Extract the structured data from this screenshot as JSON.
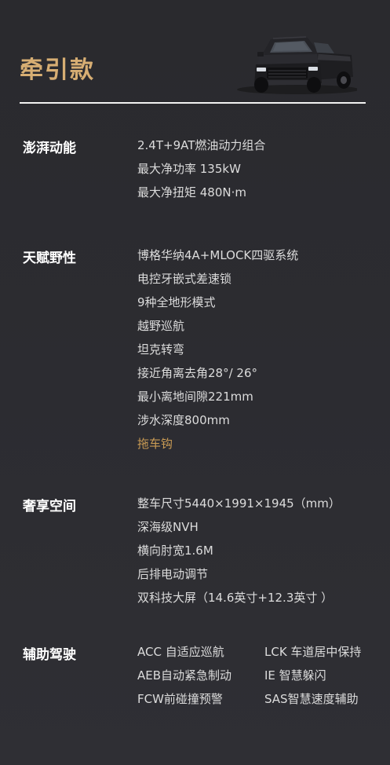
{
  "header": {
    "title": "牵引款"
  },
  "sections": [
    {
      "title": "澎湃动能",
      "items": [
        "2.4T+9AT燃油动力组合",
        "最大净功率 135kW",
        "最大净扭矩 480N·m"
      ]
    },
    {
      "title": "天赋野性",
      "items": [
        "博格华纳4A+MLOCK四驱系统",
        "电控牙嵌式差速锁",
        "9种全地形模式",
        "越野巡航",
        "坦克转弯",
        "接近角离去角28°/ 26°",
        "最小离地间隙221mm",
        "涉水深度800mm"
      ],
      "highlight_item": "拖车钩"
    },
    {
      "title": "奢享空间",
      "items": [
        "整车尺寸5440×1991×1945（mm）",
        "深海级NVH",
        "横向肘宽1.6M",
        "后排电动调节",
        "双科技大屏（14.6英寸+12.3英寸 ）"
      ]
    },
    {
      "title": "辅助驾驶",
      "rows": [
        [
          "ACC 自适应巡航",
          "LCK 车道居中保持"
        ],
        [
          "AEB自动紧急制动",
          "IE 智慧躲闪"
        ],
        [
          "FCW前碰撞预警",
          "SAS智慧速度辅助"
        ]
      ]
    }
  ],
  "colors": {
    "accent": "#d7ae73",
    "highlight": "#c89a54",
    "background": "#2c2c31"
  },
  "icons": {
    "truck": "pickup-truck-image"
  }
}
